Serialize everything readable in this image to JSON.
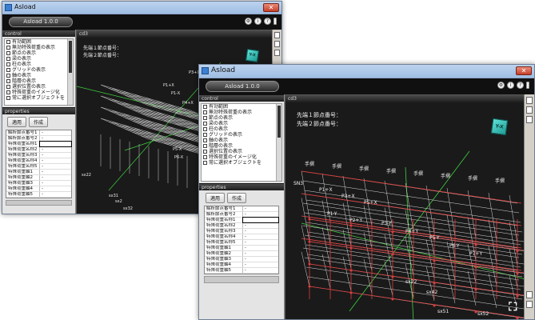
{
  "app": {
    "title": "Asload",
    "version_tab": "Asload 1.0.0",
    "view_label": "cd3"
  },
  "panels": {
    "control_label": "control",
    "properties_label": "properties",
    "control_items": [
      "有効範囲",
      "無効特殊荷重の表示",
      "節点の表示",
      "梁の表示",
      "柱の表示",
      "グリッドの表示",
      "軸の表示",
      "階層の表示",
      "選択位置の表示",
      "特殊荷重のイメージ化",
      "常に選択オブジェクトを"
    ],
    "apply_button": "適用",
    "create_button": "作成",
    "property_rows": [
      {
        "key": "解析節点番号1",
        "value": "-"
      },
      {
        "key": "解析節点番号2",
        "value": "-"
      },
      {
        "key": "特殊荷重名称1",
        "value": ""
      },
      {
        "key": "特殊荷重名称2",
        "value": "-"
      },
      {
        "key": "特殊荷重名称3",
        "value": "-"
      },
      {
        "key": "特殊荷重名称4",
        "value": "-"
      },
      {
        "key": "特殊荷重名称5",
        "value": "-"
      },
      {
        "key": "特殊荷重軸1",
        "value": "-"
      },
      {
        "key": "特殊荷重軸2",
        "value": "-"
      },
      {
        "key": "特殊荷重軸3",
        "value": "-"
      },
      {
        "key": "特殊荷重軸4",
        "value": "-"
      },
      {
        "key": "特殊荷重軸5",
        "value": "-"
      }
    ]
  },
  "viewport": {
    "node_info_1": "先端１節点番号：",
    "node_info_2": "先端２節点番号：",
    "cube_label": "Y-X",
    "floor_labels_back": [
      "P3+X",
      "P1+X",
      "P1-X",
      "P4+X",
      "P5-X",
      "P6-X"
    ],
    "labels_back_bottom": [
      "sx22",
      "sx31",
      "sx2",
      "sx32"
    ],
    "floor_labels_front": [
      "P1+X",
      "P3+X",
      "P5+X",
      "P1-Y",
      "P2+Y",
      "P3-Y",
      "P4+Y",
      "P5-Y",
      "P6-Y",
      "P7+Y"
    ],
    "top_labels_front": [
      "手摺",
      "手摺",
      "手摺",
      "手摺",
      "手摺",
      "手摺",
      "手摺",
      "手摺"
    ],
    "labels_front_bottom": [
      "sx22",
      "sx42",
      "sx51",
      "sx52",
      "SN3"
    ]
  },
  "colors": {
    "accent": "#9fbde3",
    "grid_white": "#d8d8d8",
    "beam_red": "#e03c3c",
    "axis_green": "#3fd23f"
  }
}
